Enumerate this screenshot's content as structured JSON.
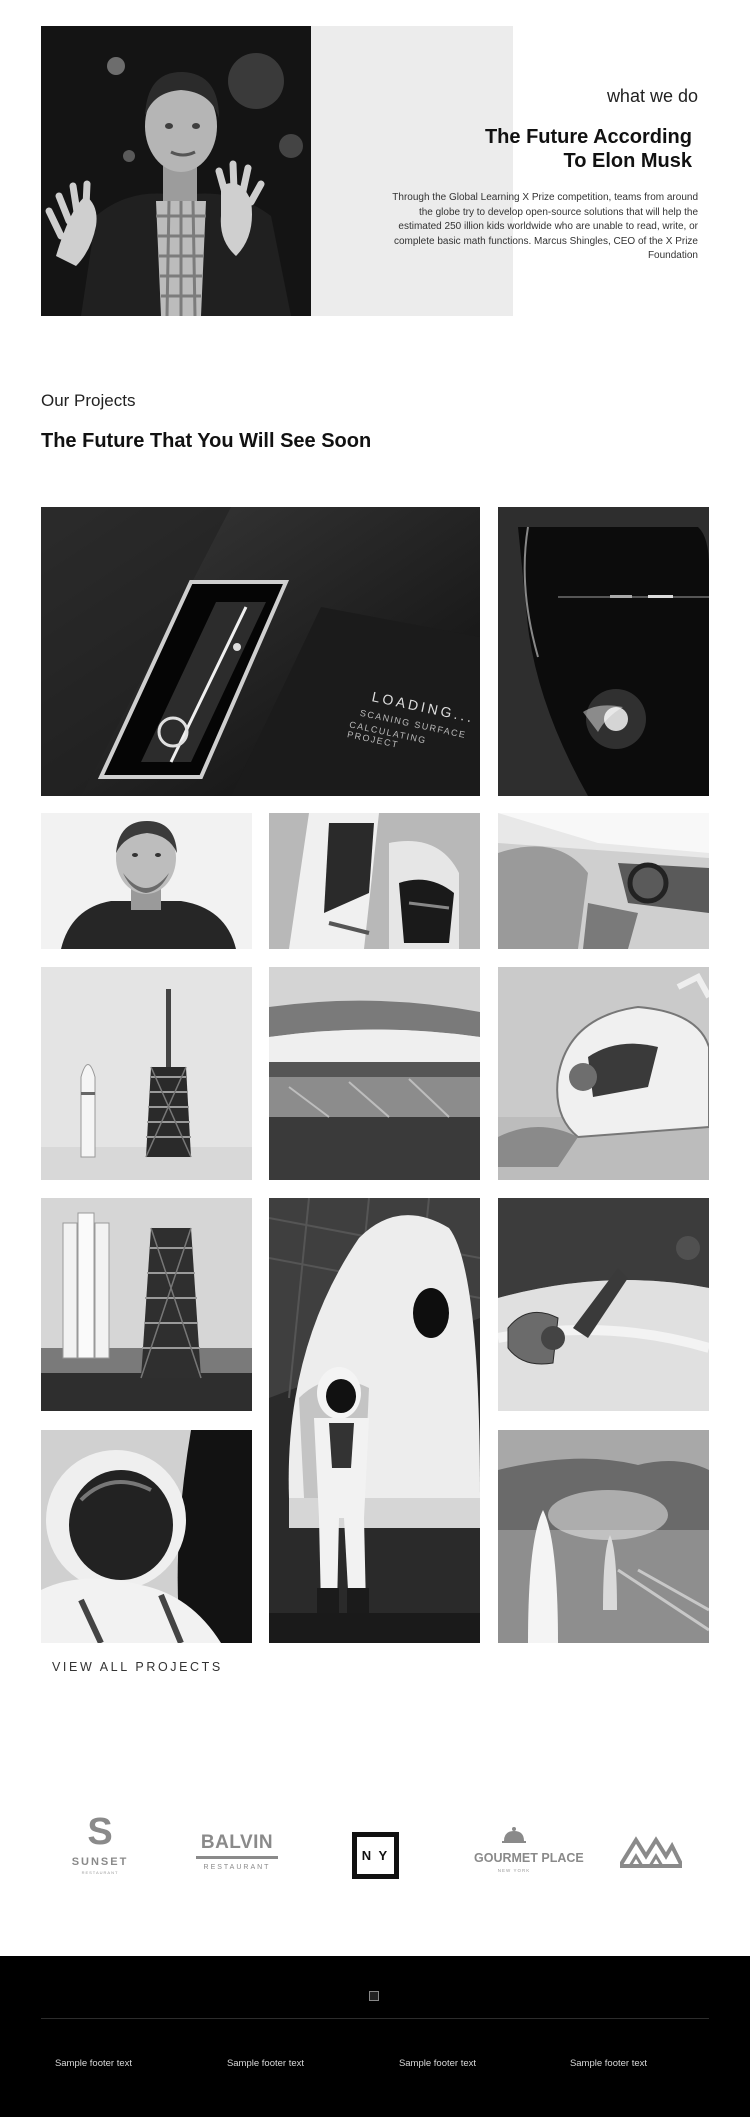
{
  "hero": {
    "kicker": "what we do",
    "title": "The Future According To Elon Musk",
    "description": "Through the Global Learning X Prize competition, teams from around the globe try to develop open-source solutions that will help the estimated 250 illion kids worldwide who are unable to read, write, or complete basic math functions. Marcus Shingles, CEO of the X Prize Foundation",
    "photo_icon": "speaker-portrait-photo"
  },
  "projects": {
    "kicker": "Our Projects",
    "title": "The Future That You Will See Soon",
    "view_all": "VIEW ALL PROJECTS",
    "tiles": [
      {
        "name": "device-loading-screen-photo",
        "screen_text": [
          "LOADING...",
          "SCANING SURFACE",
          "CALCULATING PROJECT"
        ]
      },
      {
        "name": "truck-headlight-photo"
      },
      {
        "name": "smiling-man-portrait-photo"
      },
      {
        "name": "spacesuit-boots-photo"
      },
      {
        "name": "car-interior-photo"
      },
      {
        "name": "rocket-launchpad-photo"
      },
      {
        "name": "hyperloop-station-photo"
      },
      {
        "name": "futuristic-motorbike-photo"
      },
      {
        "name": "rocket-on-pad-photo"
      },
      {
        "name": "astronaut-and-capsule-photo"
      },
      {
        "name": "satellite-over-planet-photo"
      },
      {
        "name": "astronaut-helmet-photo"
      },
      {
        "name": "starship-on-field-photo"
      }
    ]
  },
  "logos": {
    "sunset": {
      "letter": "S",
      "name": "SUNSET",
      "sub": "RESTAURANT"
    },
    "balvin": {
      "name": "BALVIN",
      "sub": "RESTAURANT"
    },
    "ny": {
      "name": "N Y"
    },
    "gourmet": {
      "name": "GOURMET PLACE",
      "sub": "NEW YORK"
    },
    "mountain": {
      "icon": "mountain-logo-icon"
    }
  },
  "footer": {
    "columns": [
      "Sample footer text",
      "Sample footer text",
      "Sample footer text",
      "Sample footer text"
    ],
    "image_icon": "broken-image-icon"
  },
  "colors": {
    "background": "#ffffff",
    "hero_panel": "#ececec",
    "footer": "#000000",
    "text": "#111111",
    "logo_gray": "#8a8a8a"
  }
}
